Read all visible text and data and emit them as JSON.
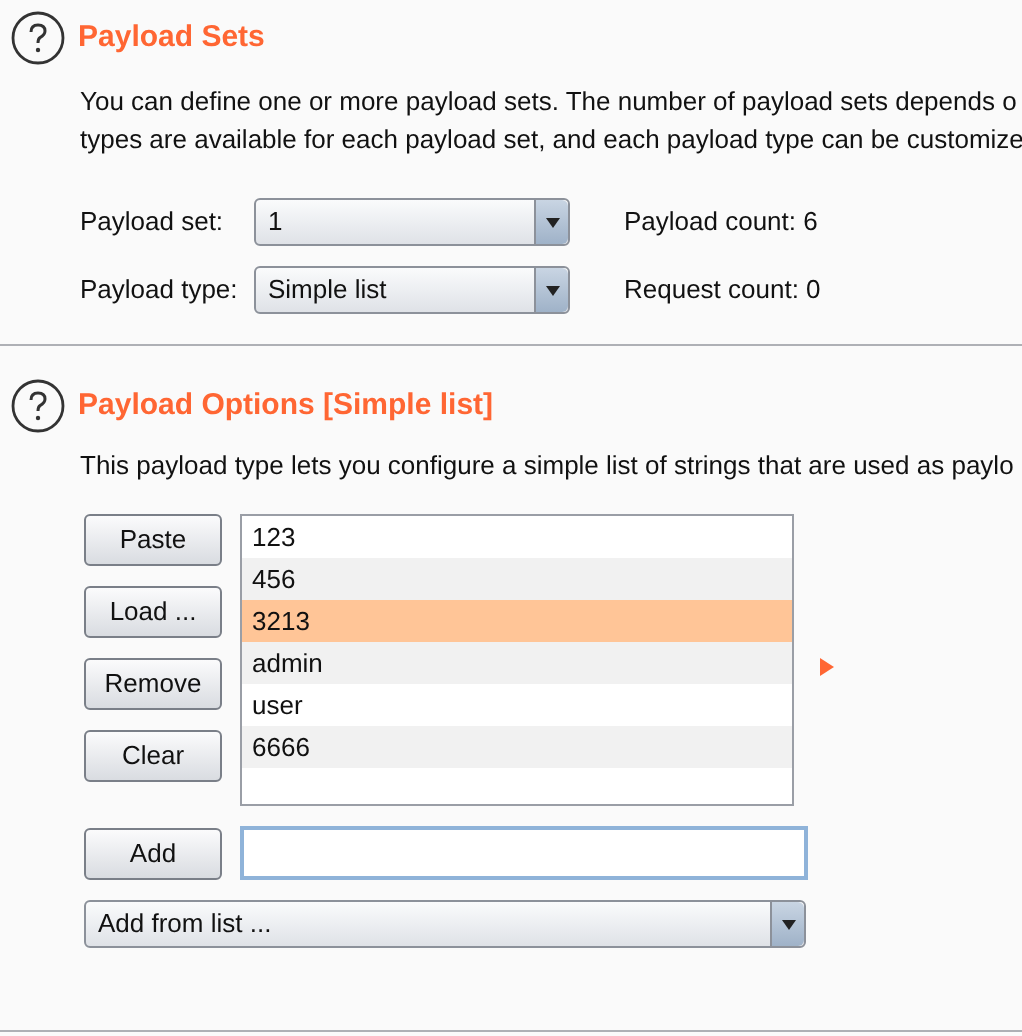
{
  "payload_sets": {
    "title": "Payload Sets",
    "description": [
      "You can define one or more payload sets. The number of payload sets depends o",
      "types are available for each payload set, and each payload type can be customize"
    ],
    "fields": [
      {
        "label": "Payload set:",
        "value": "1",
        "info": "Payload count: 6"
      },
      {
        "label": "Payload type:",
        "value": "Simple list",
        "info": "Request count: 0"
      }
    ]
  },
  "payload_options": {
    "title": "Payload Options [Simple list]",
    "description": "This payload type lets you configure a simple list of strings that are used as paylo",
    "buttons": [
      "Paste",
      "Load ...",
      "Remove",
      "Clear"
    ],
    "items": [
      {
        "text": "123",
        "selected": false
      },
      {
        "text": "456",
        "selected": false
      },
      {
        "text": "3213",
        "selected": true
      },
      {
        "text": "admin",
        "selected": false
      },
      {
        "text": "user",
        "selected": false
      },
      {
        "text": "6666",
        "selected": false
      }
    ],
    "add_button": "Add",
    "add_from_list": "Add from list ..."
  }
}
